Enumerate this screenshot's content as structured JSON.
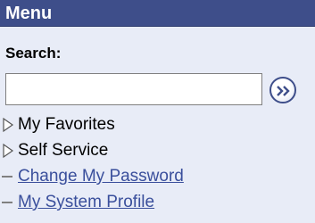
{
  "menu": {
    "title": "Menu",
    "search": {
      "label": "Search:",
      "value": "",
      "placeholder": ""
    },
    "go_button_icon": "double-chevron-right-icon",
    "items": [
      {
        "label": "My Favorites",
        "kind": "folder",
        "icon": "expand-triangle-icon"
      },
      {
        "label": "Self Service",
        "kind": "folder",
        "icon": "expand-triangle-icon"
      },
      {
        "label": "Change My Password",
        "kind": "link",
        "icon": "dash-icon"
      },
      {
        "label": "My System Profile",
        "kind": "link",
        "icon": "dash-icon"
      }
    ],
    "colors": {
      "header_bg": "#3e4e8a",
      "panel_bg": "#e8ecf7",
      "link": "#3a4f9c"
    }
  }
}
